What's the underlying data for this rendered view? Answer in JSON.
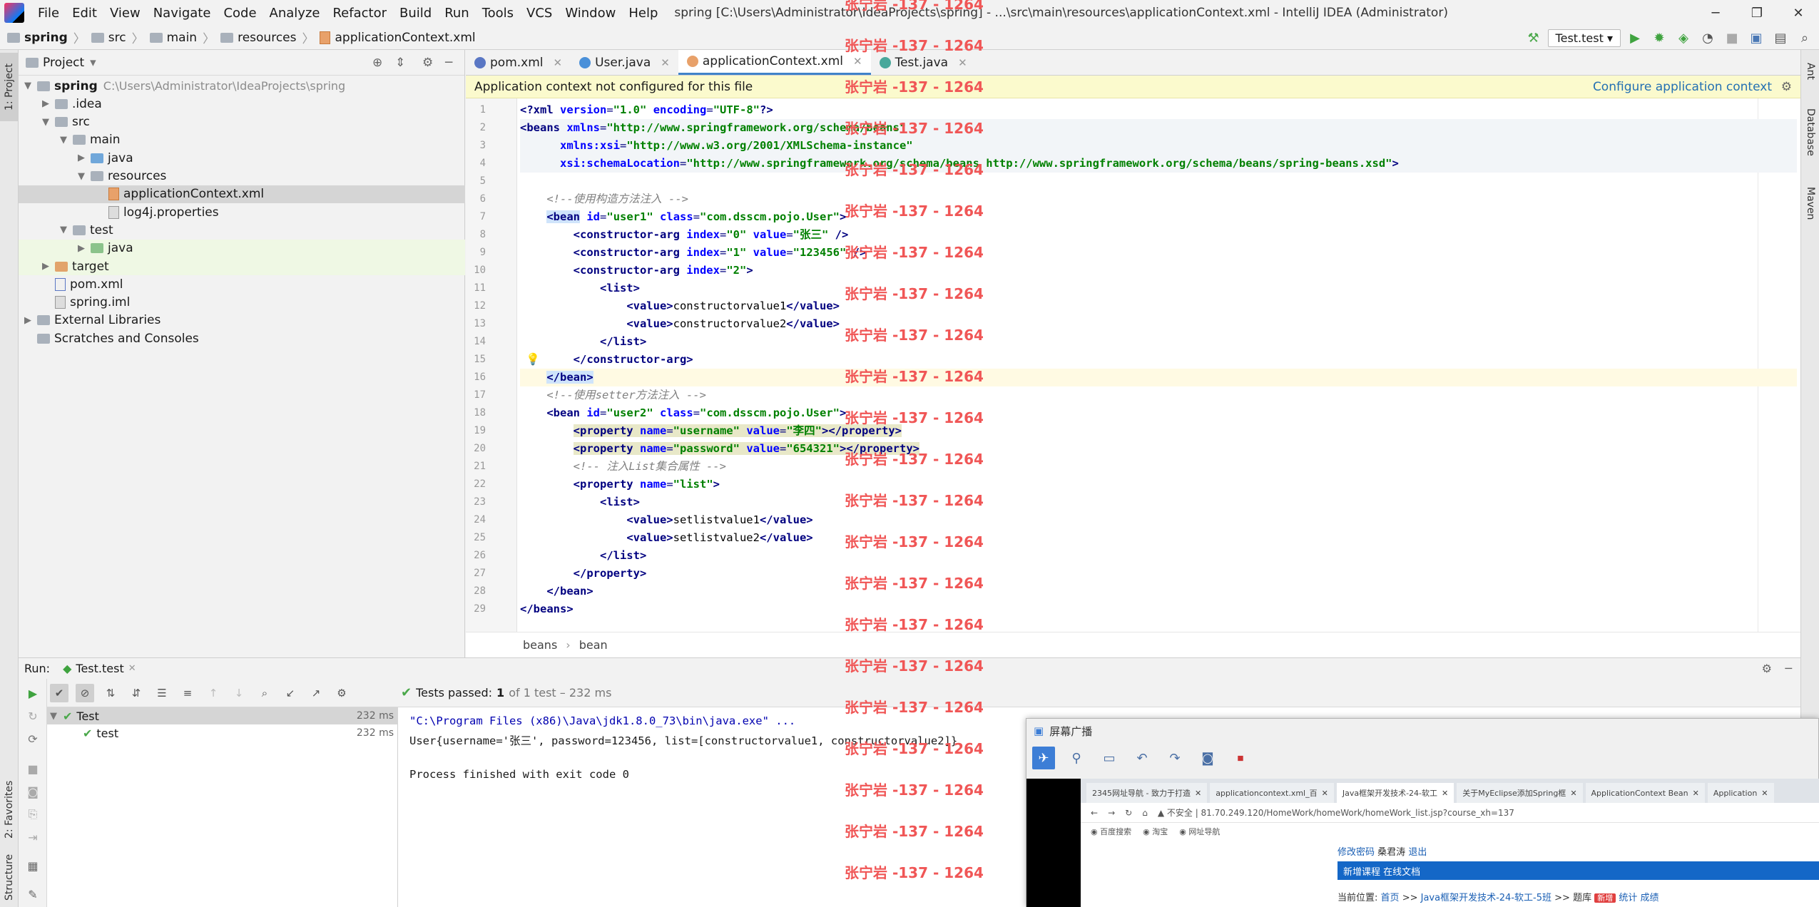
{
  "window": {
    "title": "spring [C:\\Users\\Administrator\\IdeaProjects\\spring] - ...\\src\\main\\resources\\applicationContext.xml - IntelliJ IDEA (Administrator)",
    "minimize": "─",
    "restore": "❐",
    "close": "✕"
  },
  "menu": [
    "File",
    "Edit",
    "View",
    "Navigate",
    "Code",
    "Analyze",
    "Refactor",
    "Build",
    "Run",
    "Tools",
    "VCS",
    "Window",
    "Help"
  ],
  "breadcrumb": [
    "spring",
    "src",
    "main",
    "resources",
    "applicationContext.xml"
  ],
  "run_config": "Test.test",
  "left_strip": {
    "project": "1: Project",
    "favorites": "2: Favorites",
    "structure": "Structure"
  },
  "right_strip": {
    "ant": "Ant",
    "database": "Database",
    "maven": "Maven"
  },
  "project_panel": {
    "title": "Project",
    "tree": [
      {
        "label": "spring",
        "path": "C:\\Users\\Administrator\\IdeaProjects\\spring",
        "depth": 0,
        "arrow": "▼",
        "icon": "folder",
        "bold": true
      },
      {
        "label": ".idea",
        "depth": 1,
        "arrow": "▶",
        "icon": "folder"
      },
      {
        "label": "src",
        "depth": 1,
        "arrow": "▼",
        "icon": "folder"
      },
      {
        "label": "main",
        "depth": 2,
        "arrow": "▼",
        "icon": "folder"
      },
      {
        "label": "java",
        "depth": 3,
        "arrow": "▶",
        "icon": "folder-blue"
      },
      {
        "label": "resources",
        "depth": 3,
        "arrow": "▼",
        "icon": "folder"
      },
      {
        "label": "applicationContext.xml",
        "depth": 4,
        "arrow": "",
        "icon": "file-xml",
        "selected": true
      },
      {
        "label": "log4j.properties",
        "depth": 4,
        "arrow": "",
        "icon": "file-properties"
      },
      {
        "label": "test",
        "depth": 2,
        "arrow": "▼",
        "icon": "folder"
      },
      {
        "label": "java",
        "depth": 3,
        "arrow": "▶",
        "icon": "folder-green",
        "highlight": true
      },
      {
        "label": "target",
        "depth": 1,
        "arrow": "▶",
        "icon": "folder-orange",
        "highlight": true
      },
      {
        "label": "pom.xml",
        "depth": 1,
        "arrow": "",
        "icon": "file-maven"
      },
      {
        "label": "spring.iml",
        "depth": 1,
        "arrow": "",
        "icon": "file-iml"
      },
      {
        "label": "External Libraries",
        "depth": 0,
        "arrow": "▶",
        "icon": "library"
      },
      {
        "label": "Scratches and Consoles",
        "depth": 0,
        "arrow": "",
        "icon": "scratches"
      }
    ]
  },
  "editor_tabs": [
    {
      "label": "pom.xml",
      "icon_color": "#5a77c4",
      "active": false
    },
    {
      "label": "User.java",
      "icon_color": "#4a90d9",
      "active": false
    },
    {
      "label": "applicationContext.xml",
      "icon_color": "#e8a16a",
      "active": true
    },
    {
      "label": "Test.java",
      "icon_color": "#48a89b",
      "active": false
    }
  ],
  "notice": {
    "text": "Application context not configured for this file",
    "link": "Configure application context"
  },
  "code_lines": [
    "1",
    "2",
    "3",
    "4",
    "5",
    "6",
    "7",
    "8",
    "9",
    "10",
    "11",
    "12",
    "13",
    "14",
    "15",
    "16",
    "17",
    "18",
    "19",
    "20",
    "21",
    "22",
    "23",
    "24",
    "25",
    "26",
    "27",
    "28",
    "29"
  ],
  "code": {
    "l1_tag": "<?xml ",
    "l1_a1": "version",
    "l1_v1": "\"1.0\"",
    "l1_a2": "encoding",
    "l1_v2": "\"UTF-8\"",
    "l1_end": "?>",
    "l2_tag": "<beans ",
    "l2_a": "xmlns",
    "l2_v": "\"http://www.springframework.org/schema/beans\"",
    "l3_a": "xmlns:xsi",
    "l3_v": "\"http://www.w3.org/2001/XMLSchema-instance\"",
    "l4_a": "xsi:schemaLocation",
    "l4_v": "\"http://www.springframework.org/schema/beans http://www.springframework.org/schema/beans/spring-beans.xsd\"",
    "l4_end": ">",
    "l6": "<!--使用构造方法注入 -->",
    "l7_tag": "<bean",
    "l7_a1": "id",
    "l7_v1": "\"user1\"",
    "l7_a2": "class",
    "l7_v2": "\"com.dsscm.pojo.User\"",
    "l7_end": ">",
    "l8_tag": "<constructor-arg ",
    "l8_a1": "index",
    "l8_v1": "\"0\"",
    "l8_a2": "value",
    "l8_v2": "\"张三\"",
    "l8_end": " />",
    "l9_tag": "<constructor-arg ",
    "l9_a1": "index",
    "l9_v1": "\"1\"",
    "l9_a2": "value",
    "l9_v2": "\"123456\"",
    "l9_end": " />",
    "l10_tag": "<constructor-arg ",
    "l10_a1": "index",
    "l10_v1": "\"2\"",
    "l10_end": ">",
    "l11": "<list>",
    "l12_o": "<value>",
    "l12_t": "constructorvalue1",
    "l12_c": "</value>",
    "l13_o": "<value>",
    "l13_t": "constructorvalue2",
    "l13_c": "</value>",
    "l14": "</list>",
    "l15": "</constructor-arg>",
    "l16": "</bean>",
    "l17": "<!--使用setter方法注入 -->",
    "l18_tag": "<bean",
    "l18_a1": "id",
    "l18_v1": "\"user2\"",
    "l18_a2": "class",
    "l18_v2": "\"com.dsscm.pojo.User\"",
    "l18_end": ">",
    "l19_tag": "<property ",
    "l19_a1": "name",
    "l19_v1": "\"username\"",
    "l19_a2": "value",
    "l19_v2": "\"李四\"",
    "l19_end": "></property>",
    "l20_tag": "<property ",
    "l20_a1": "name",
    "l20_v1": "\"password\"",
    "l20_a2": "value",
    "l20_v2": "\"654321\"",
    "l20_end": "></property>",
    "l21": "<!-- 注入List集合属性 -->",
    "l22_tag": "<property ",
    "l22_a1": "name",
    "l22_v1": "\"list\"",
    "l22_end": ">",
    "l23": "<list>",
    "l24_o": "<value>",
    "l24_t": "setlistvalue1",
    "l24_c": "</value>",
    "l25_o": "<value>",
    "l25_t": "setlistvalue2",
    "l25_c": "</value>",
    "l26": "</list>",
    "l27": "</property>",
    "l28": "</bean>",
    "l29": "</beans>"
  },
  "editor_breadcrumb": [
    "beans",
    "bean"
  ],
  "run_panel": {
    "label": "Run:",
    "tab": "Test.test",
    "summary_status": "Tests passed:",
    "summary_count": "1",
    "summary_rest": "of 1 test – 232 ms",
    "tests": [
      {
        "name": "Test",
        "time": "232 ms"
      },
      {
        "name": "test",
        "time": "232 ms"
      }
    ],
    "console": [
      "\"C:\\Program Files (x86)\\Java\\jdk1.8.0_73\\bin\\java.exe\" ...",
      "User{username='张三', password=123456, list=[constructorvalue1, constructorvalue2]}",
      "",
      "Process finished with exit code 0"
    ]
  },
  "watermark": "张宁岩 -137 - 1264",
  "screen_share": {
    "title": "屏幕广播",
    "browser_tabs": [
      "2345网址导航 - 致力于打造",
      "applicationcontext.xml_百",
      "Java框架开发技术-24-软工",
      "关于MyEclipse添加Spring框",
      "ApplicationContext Bean",
      "Application"
    ],
    "address_label": "不安全",
    "address": "81.70.249.120/HomeWork/homeWork/homeWork_list.jsp?course_xh=137",
    "bookmarks": [
      "百度搜索",
      "淘宝",
      "网址导航"
    ],
    "links": {
      "change_pwd": "修改密码",
      "user": "桑君涛",
      "logout": "退出"
    },
    "banner": "新增课程 在线文档",
    "location_prefix": "当前位置:",
    "location_home": "首页",
    "location_sep": ">>",
    "location_course": "Java框架开发技术-24-软工-5班",
    "location_bank": "题库",
    "location_new": "新增",
    "location_stats": "统计",
    "location_grade": "成绩"
  }
}
